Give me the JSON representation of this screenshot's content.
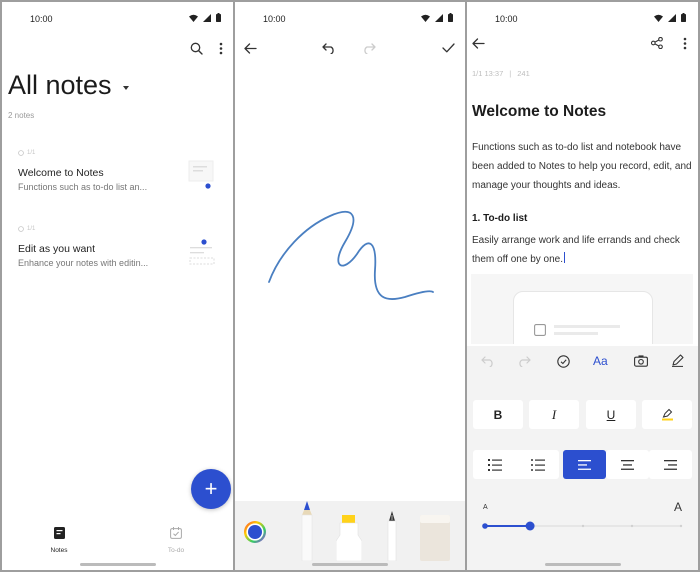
{
  "status": {
    "time": "10:00"
  },
  "list_screen": {
    "title": "All notes",
    "count": "2 notes",
    "notes": [
      {
        "meta": "1/1",
        "title": "Welcome to Notes",
        "preview": "Functions such as to-do list an..."
      },
      {
        "meta": "1/1",
        "title": "Edit as you want",
        "preview": "Enhance your notes with editin..."
      }
    ],
    "fab_label": "+",
    "nav": {
      "notes": "Notes",
      "todo": "To-do"
    }
  },
  "draw_screen": {
    "icons": [
      "back-arrow-icon",
      "undo-icon",
      "redo-icon",
      "check-icon"
    ],
    "stroke_color": "#4a7fc1",
    "tools": [
      "color-picker",
      "pencil",
      "highlighter",
      "fountain-pen",
      "eraser"
    ]
  },
  "note_screen": {
    "meta_date": "1/1 13:37",
    "meta_count": "241",
    "title": "Welcome to Notes",
    "body": "Functions such as to-do list and notebook have been added to Notes to help you record, edit, and manage your thoughts and ideas.",
    "section_heading": "1. To-do list",
    "section_body": "Easily arrange work and life errands and check them off one by one.",
    "toolbar": {
      "font_label": "Aa"
    },
    "format": {
      "bold": "B",
      "italic": "I",
      "underline": "U"
    },
    "size_small": "A",
    "size_large": "A",
    "size_level": 0.23
  },
  "colors": {
    "accent": "#2c4fcf",
    "stroke": "#4a7fc1"
  }
}
